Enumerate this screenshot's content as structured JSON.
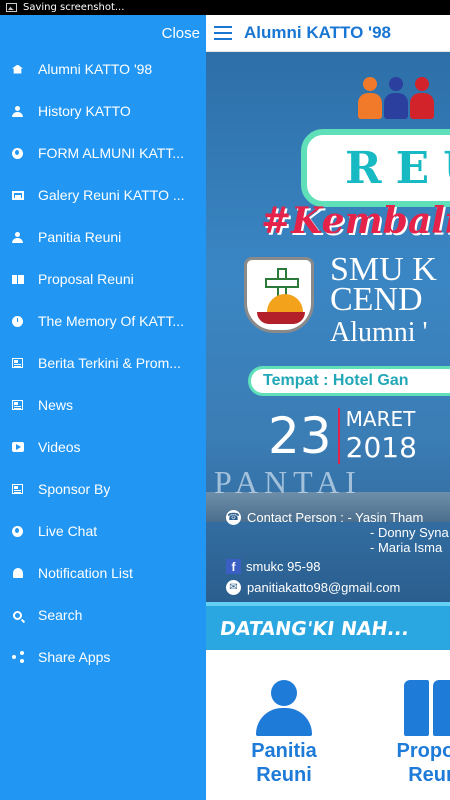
{
  "status_bar": {
    "text": "Saving screenshot..."
  },
  "drawer": {
    "close_label": "Close",
    "items": [
      {
        "label": "Alumni KATTO '98",
        "icon": "home-icon"
      },
      {
        "label": "History KATTO",
        "icon": "person-icon"
      },
      {
        "label": "FORM ALMUNI KATT...",
        "icon": "globe-icon"
      },
      {
        "label": "Galery Reuni KATTO ...",
        "icon": "photos-icon"
      },
      {
        "label": "Panitia Reuni",
        "icon": "person-icon"
      },
      {
        "label": "Proposal Reuni",
        "icon": "book-icon"
      },
      {
        "label": "The Memory Of KATT...",
        "icon": "clock-icon"
      },
      {
        "label": "Berita Terkini & Prom...",
        "icon": "news-icon"
      },
      {
        "label": "News",
        "icon": "news-icon"
      },
      {
        "label": "Videos",
        "icon": "video-icon"
      },
      {
        "label": "Sponsor By",
        "icon": "news-icon"
      },
      {
        "label": "Live Chat",
        "icon": "globe-icon"
      },
      {
        "label": "Notification List",
        "icon": "bell-icon"
      },
      {
        "label": "Search",
        "icon": "search-icon"
      },
      {
        "label": "Share Apps",
        "icon": "share-icon"
      }
    ]
  },
  "toolbar": {
    "title": "Alumni KATTO '98"
  },
  "banner": {
    "reuni": "REU",
    "hashtag": "#Kembalik",
    "school_line1": "SMU K",
    "school_line2": "CEND",
    "school_line3": "Alumni '",
    "tempat": "Tempat : Hotel Gan",
    "date_day": "23",
    "date_month": "MARET",
    "date_year": "2018",
    "pantai": "PANTAI",
    "contact_line1": "Contact Person : - Yasin Tham",
    "contact_line2": "- Donny Syna",
    "contact_line3": "- Maria Isma",
    "fb": "smukc 95-98",
    "email": "panitiakatto98@gmail.com"
  },
  "datang": {
    "text": "DATANG'KI NAH..."
  },
  "cards": [
    {
      "line1": "Panitia",
      "line2": "Reuni"
    },
    {
      "line1": "Propos",
      "line2": "Reur"
    }
  ],
  "colors": {
    "drawer_bg": "#2196f3",
    "accent": "#1976d2",
    "reuni_teal": "#5fe0b8",
    "hashtag_red": "#e5224a"
  }
}
